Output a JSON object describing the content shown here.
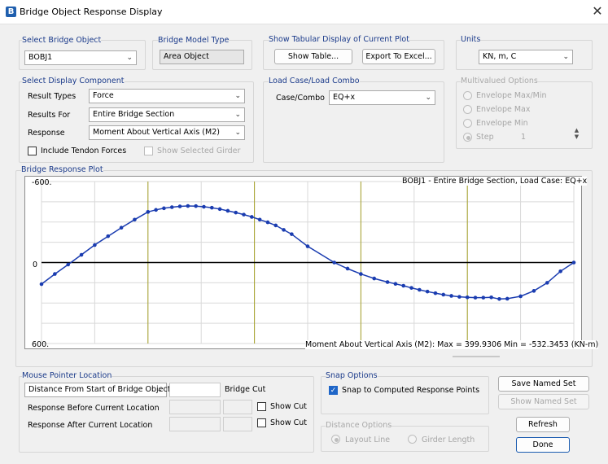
{
  "window": {
    "title": "Bridge Object Response Display",
    "app_icon": "B",
    "close": "✕"
  },
  "select_object": {
    "label": "Select Bridge Object",
    "value": "BOBJ1"
  },
  "model_type": {
    "label": "Bridge Model Type",
    "value": "Area Object"
  },
  "tabular": {
    "label": "Show Tabular Display of Current Plot",
    "show_table": "Show Table...",
    "export_excel": "Export To Excel..."
  },
  "units": {
    "label": "Units",
    "value": "KN, m, C"
  },
  "display_component": {
    "label": "Select Display Component",
    "result_types_label": "Result Types",
    "result_types_value": "Force",
    "results_for_label": "Results For",
    "results_for_value": "Entire Bridge Section",
    "response_label": "Response",
    "response_value": "Moment About Vertical Axis  (M2)",
    "tendon_label": "Include Tendon Forces",
    "girder_label": "Show Selected Girder"
  },
  "load_case": {
    "label": "Load Case/Load Combo",
    "case_label": "Case/Combo",
    "case_value": "EQ+x"
  },
  "multivalued": {
    "label": "Multivalued Options",
    "opt1": "Envelope Max/Min",
    "opt2": "Envelope Max",
    "opt3": "Envelope Min",
    "opt4": "Step",
    "step_value": "1"
  },
  "plot": {
    "label": "Bridge Response Plot",
    "header": "BOBJ1 - Entire Bridge Section,  Load Case: EQ+x",
    "y_top": "-600.",
    "y_zero": "0",
    "y_bottom": "600.",
    "footer": "Moment About Vertical Axis  (M2):  Max = 399.9306    Min = -532.3453  (KN-m)",
    "curve_color": "#1a3cb0",
    "support_line_color": "#a6a22a"
  },
  "chart_data": {
    "type": "line",
    "title": "BOBJ1 - Entire Bridge Section,  Load Case: EQ+x",
    "xlabel": "",
    "ylabel": "",
    "ylim": [
      600,
      -600
    ],
    "x": [
      0,
      0.025,
      0.05,
      0.075,
      0.1,
      0.125,
      0.15,
      0.175,
      0.2,
      0.215,
      0.23,
      0.245,
      0.26,
      0.275,
      0.29,
      0.305,
      0.32,
      0.335,
      0.35,
      0.365,
      0.38,
      0.395,
      0.41,
      0.425,
      0.44,
      0.455,
      0.47,
      0.5,
      0.55,
      0.575,
      0.6,
      0.625,
      0.65,
      0.665,
      0.68,
      0.695,
      0.71,
      0.725,
      0.74,
      0.755,
      0.77,
      0.785,
      0.8,
      0.815,
      0.83,
      0.845,
      0.86,
      0.875,
      0.9,
      0.925,
      0.95,
      0.975,
      1.0
    ],
    "series": [
      {
        "values": [
          160,
          85,
          15,
          -57,
          -130,
          -195,
          -258,
          -318,
          -375,
          -390,
          -402,
          -410,
          -416,
          -419,
          -418,
          -413,
          -406,
          -396,
          -383,
          -370,
          -355,
          -338,
          -318,
          -298,
          -275,
          -242,
          -210,
          -120,
          0,
          45,
          85,
          118,
          145,
          158,
          172,
          188,
          202,
          215,
          227,
          238,
          247,
          254,
          258,
          260,
          260,
          258,
          270,
          268,
          250,
          210,
          150,
          65,
          0
        ]
      }
    ],
    "grid": true,
    "legend": "none"
  },
  "mouse_pointer": {
    "label": "Mouse Pointer Location",
    "distance_value": "Distance From Start of Bridge Object",
    "bridge_cut_label": "Bridge Cut",
    "before_label": "Response Before Current Location",
    "after_label": "Response After Current Location",
    "show_cut1": "Show Cut",
    "show_cut2": "Show Cut"
  },
  "snap": {
    "label": "Snap Options",
    "computed_label": "Snap to Computed Response Points"
  },
  "distance_options": {
    "label": "Distance Options",
    "layout_line": "Layout Line",
    "girder_length": "Girder Length"
  },
  "buttons": {
    "save_named": "Save Named Set",
    "show_named": "Show Named Set",
    "refresh": "Refresh",
    "done": "Done"
  },
  "icons": {
    "dropdown": "chevron-down-icon",
    "check": "✓"
  }
}
